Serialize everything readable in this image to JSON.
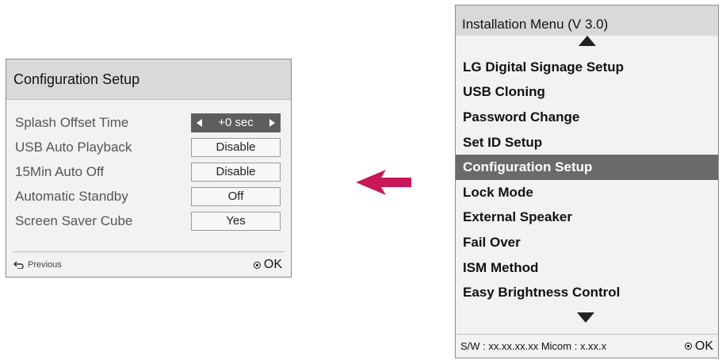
{
  "config_panel": {
    "title": "Configuration Setup",
    "rows": [
      {
        "label": "Splash Offset Time",
        "value": "+0 sec",
        "active": true
      },
      {
        "label": "USB Auto Playback",
        "value": "Disable"
      },
      {
        "label": "15Min Auto Off",
        "value": "Disable"
      },
      {
        "label": "Automatic Standby",
        "value": "Off"
      },
      {
        "label": "Screen Saver Cube",
        "value": "Yes"
      }
    ],
    "footer": {
      "previous_label": "Previous",
      "ok_label": "OK"
    }
  },
  "install_panel": {
    "title": "Installation Menu (V 3.0)",
    "items": [
      {
        "label": "LG Digital Signage Setup"
      },
      {
        "label": "USB Cloning"
      },
      {
        "label": "Password Change"
      },
      {
        "label": "Set ID Setup"
      },
      {
        "label": "Configuration Setup",
        "selected": true
      },
      {
        "label": "Lock Mode"
      },
      {
        "label": "External Speaker"
      },
      {
        "label": "Fail Over"
      },
      {
        "label": "ISM Method"
      },
      {
        "label": "Easy Brightness Control"
      }
    ],
    "footer": {
      "sw_info": "S/W : xx.xx.xx.xx Micom : x.xx.x",
      "ok_label": "OK"
    }
  },
  "colors": {
    "arrow": "#c8185a",
    "selected_bg": "#6a6a6a",
    "header_bg": "#d9d9d9"
  }
}
